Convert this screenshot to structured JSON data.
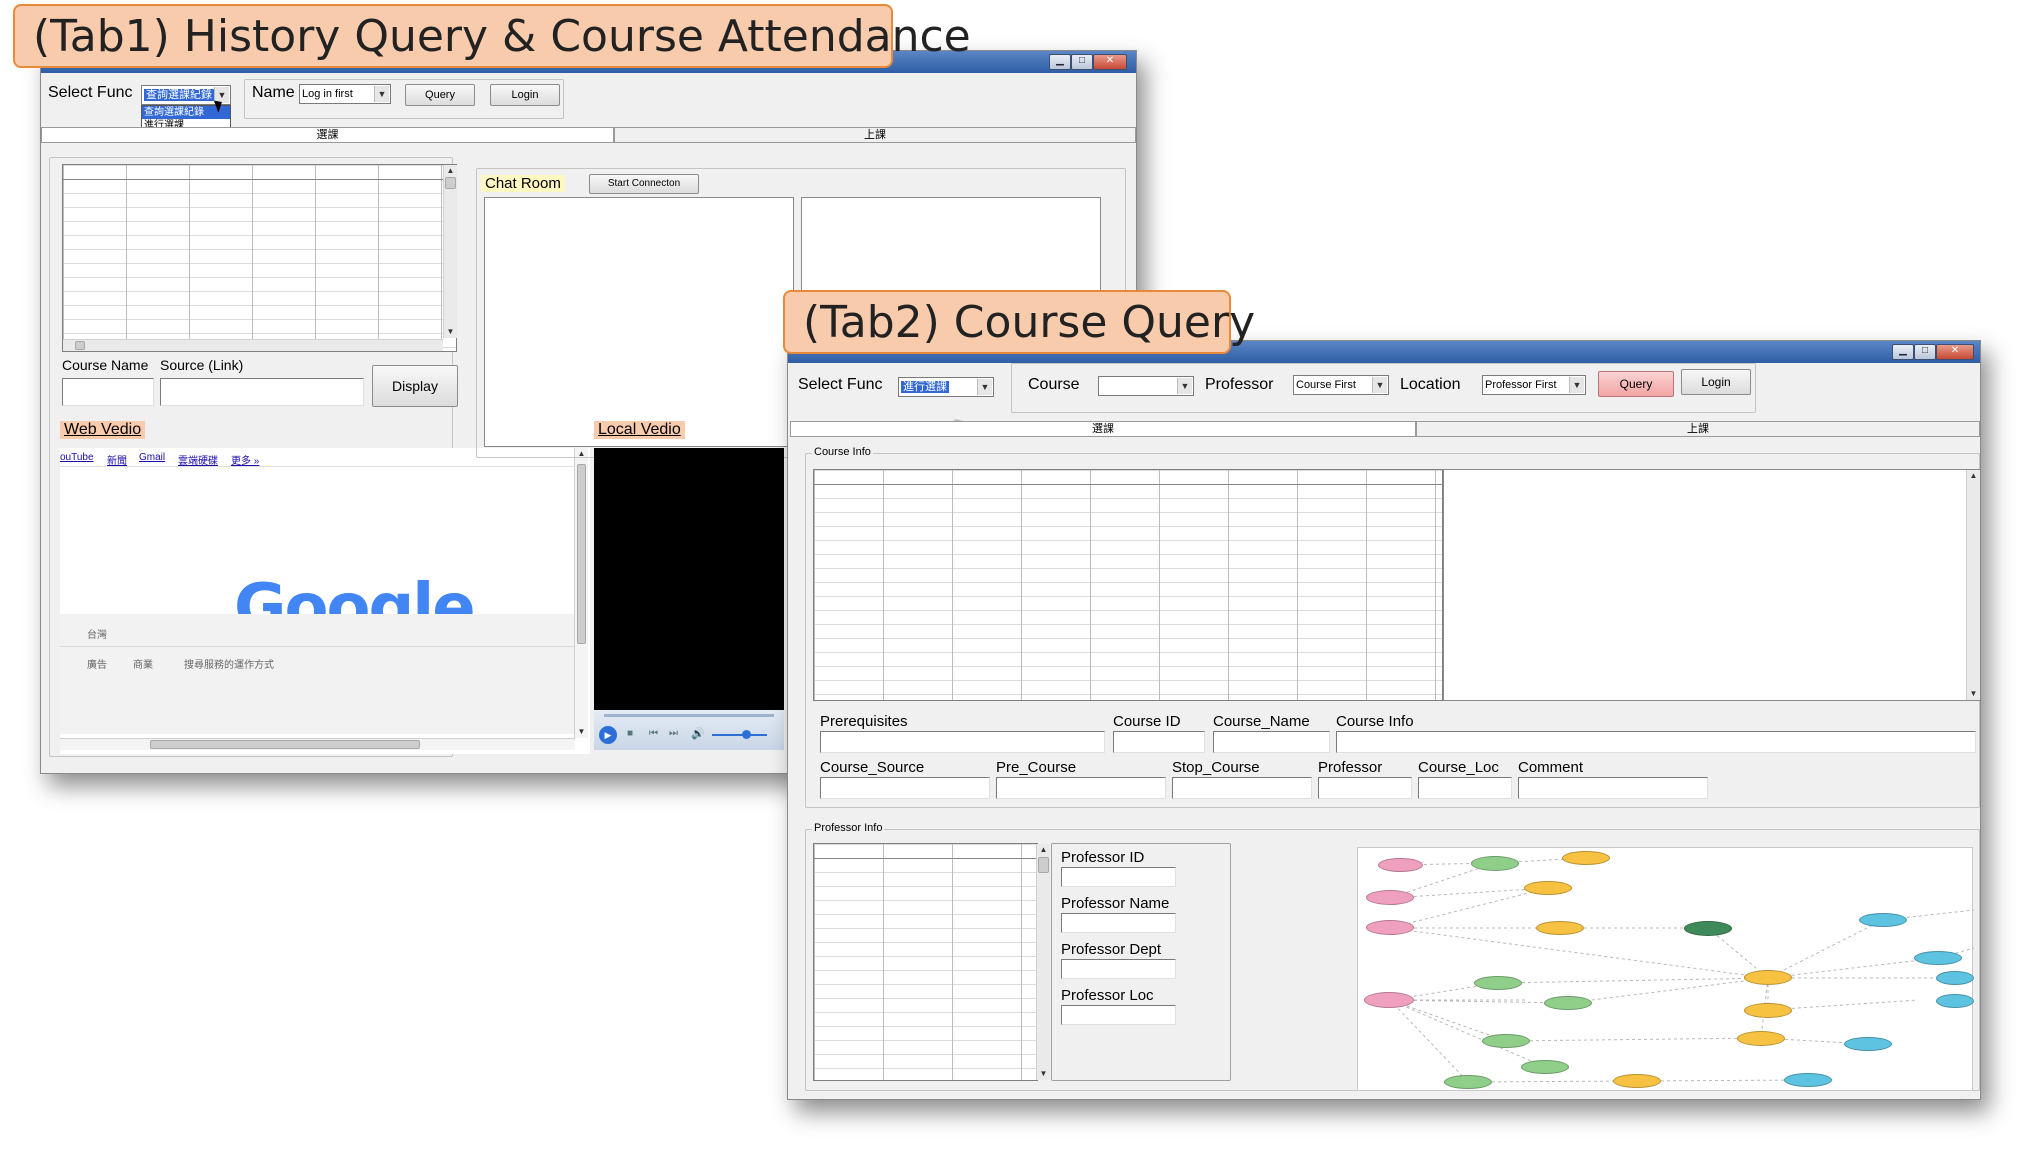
{
  "callouts": {
    "tab1": "(Tab1) History Query & Course Attendance",
    "tab2": "(Tab2) Course Query"
  },
  "tab1": {
    "select_func_label": "Select Func",
    "select_func_value": "查詢選課紀錄",
    "dropdown_options": [
      "查詢選課紀錄",
      "進行選課"
    ],
    "name_label": "Name",
    "name_value": "Log in first",
    "query_label": "Query",
    "login_label": "Login",
    "tabs": [
      "選課",
      "上課"
    ],
    "course_name_label": "Course Name",
    "source_label": "Source (Link)",
    "display_label": "Display",
    "chat_room_label": "Chat Room",
    "start_connection_label": "Start Connecton",
    "web_video_label": "Web Vedio",
    "local_video_label": "Local Vedio",
    "browser": {
      "links": [
        "ouTube",
        "新聞",
        "Gmail",
        "雲端硬碟",
        "更多 »"
      ],
      "logo": "Google",
      "region": "台灣",
      "footer": [
        "廣告",
        "商業",
        "搜尋服務的運作方式"
      ]
    }
  },
  "tab2": {
    "select_func_label": "Select Func",
    "select_func_value": "進行選課",
    "course_label": "Course",
    "course_value": "",
    "professor_label": "Professor",
    "professor_value": "Course First",
    "location_label": "Location",
    "location_value": "Professor First",
    "query_label": "Query",
    "login_label": "Login",
    "tabs": [
      "選課",
      "上課"
    ],
    "course_info_group": "Course Info",
    "fields_row1": [
      "Prerequisites",
      "Course ID",
      "Course_Name",
      "Course Info"
    ],
    "fields_row2": [
      "Course_Source",
      "Pre_Course",
      "Stop_Course",
      "Professor",
      "Course_Loc",
      "Comment"
    ],
    "professor_info_group": "Professor Info",
    "professor_fields": [
      "Professor ID",
      "Professor Name",
      "Professor Dept",
      "Professor Loc"
    ]
  },
  "colors": {
    "callout_fill": "#f8cbad",
    "callout_border": "#e98a3a",
    "query_button": "#f4b0b0",
    "graph_pink": "#f0a0bf",
    "graph_green": "#8fcf8a",
    "graph_yellow": "#f7c242",
    "graph_blue": "#5ec3e0",
    "graph_darkgreen": "#3f8a5a"
  }
}
